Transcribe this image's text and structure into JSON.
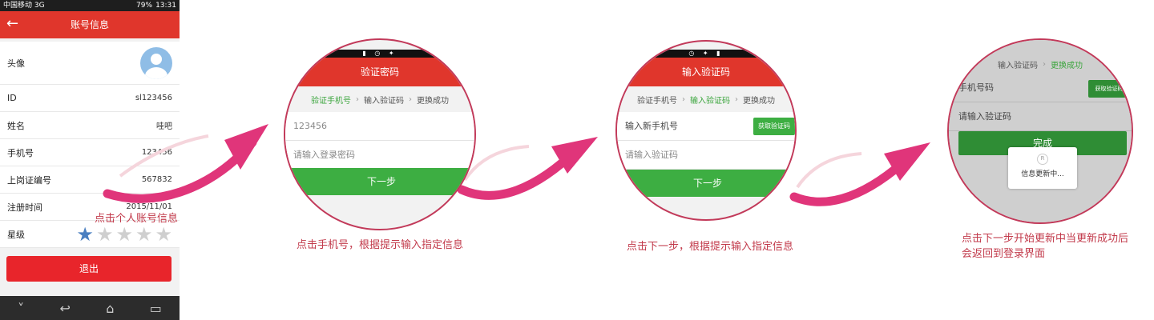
{
  "phone": {
    "status_left": "中国移动 3G",
    "status_right": "79%",
    "status_time": "13:31",
    "title": "账号信息",
    "rows": [
      {
        "label": "头像",
        "value": ""
      },
      {
        "label": "ID",
        "value": "sl123456"
      },
      {
        "label": "姓名",
        "value": "哇吧"
      },
      {
        "label": "手机号",
        "value": "123456"
      },
      {
        "label": "上岗证编号",
        "value": "567832"
      },
      {
        "label": "注册时间",
        "value": "2015/11/01"
      },
      {
        "label": "星级",
        "value": ""
      }
    ],
    "stars": {
      "filled": 1,
      "total": 5
    },
    "logout": "退出"
  },
  "hint1": "点击个人账号信息",
  "step1": {
    "title": "验证密码",
    "steps": [
      "验证手机号",
      "输入验证码",
      "更换成功"
    ],
    "field1": "123456",
    "field2": "请输入登录密码",
    "button": "下一步",
    "note": "点击手机号，根据提示输入指定信息"
  },
  "step2": {
    "title": "输入验证码",
    "steps": [
      "验证手机号",
      "输入验证码",
      "更换成功"
    ],
    "field1": "输入新手机号",
    "getcode": "获取验证码",
    "field2": "请输入验证码",
    "button": "下一步",
    "note": "点击下一步，根据提示输入指定信息"
  },
  "step3": {
    "steps": [
      "输入验证码",
      "更换成功"
    ],
    "field1": "手机号码",
    "field2": "请输入验证码",
    "button": "完成",
    "getcode": "获取验证码",
    "dialog": "信息更新中...",
    "note_line1": "点击下一步开始更新中当更新成功后",
    "note_line2": "会返回到登录界面"
  },
  "colors": {
    "accent_red": "#e0362c",
    "green": "#3dae42",
    "arrow": "#e0357a",
    "note": "#c23a4b"
  }
}
